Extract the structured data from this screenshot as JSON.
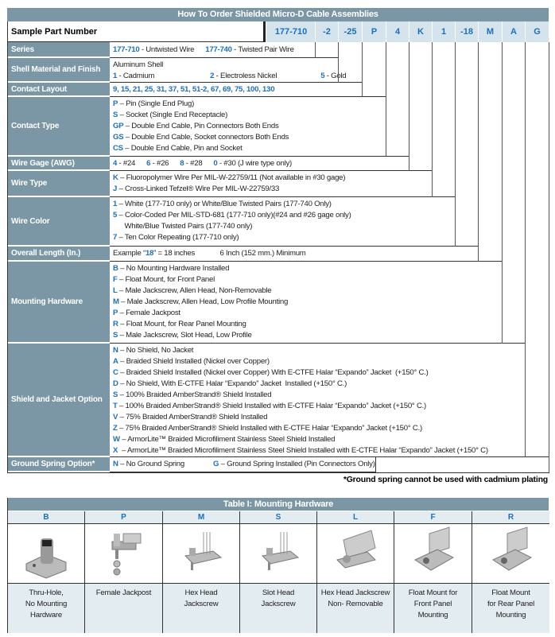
{
  "order": {
    "title": "How To Order Shielded Micro-D Cable Assemblies",
    "sample_label": "Sample Part Number",
    "part_codes": [
      "177-710",
      "-2",
      "-25",
      "P",
      "4",
      "K",
      "1",
      "-18",
      "M",
      "A",
      "G"
    ],
    "rows": [
      {
        "label": "Series",
        "lines": [
          [
            {
              "b": "177-710",
              "t": " - Untwisted Wire"
            },
            {
              "b": "177-740",
              "t": " - Twisted Pair Wire"
            }
          ]
        ]
      },
      {
        "label": "Shell Material and Finish",
        "lines": [
          [
            {
              "b": "",
              "t": "Aluminum Shell"
            }
          ],
          [
            {
              "b": "1",
              "t": " - Cadmium"
            },
            {
              "b": "2",
              "t": " - Electroless Nickel"
            },
            {
              "b": "5",
              "t": " - Gold"
            }
          ]
        ]
      },
      {
        "label": "Contact Layout",
        "lines": [
          [
            {
              "b": "9, 15, 21, 25, 31, 37, 51, 51-2, 67, 69, 75, 100, 130",
              "t": ""
            }
          ]
        ]
      },
      {
        "label": "Contact Type",
        "lines": [
          [
            {
              "b": "P",
              "t": " – Pin (Single End Plug)"
            }
          ],
          [
            {
              "b": "S",
              "t": " – Socket (Single End Receptacle)"
            }
          ],
          [
            {
              "b": "GP",
              "t": " – Double End Cable, Pin Connectors Both Ends"
            }
          ],
          [
            {
              "b": "GS",
              "t": " – Double End Cable, Socket connectors Both Ends"
            }
          ],
          [
            {
              "b": "CS",
              "t": " – Double End Cable, Pin and Socket"
            }
          ]
        ]
      },
      {
        "label": "Wire Gage (AWG)",
        "lines": [
          [
            {
              "b": "4",
              "t": " - #24"
            },
            {
              "b": "6",
              "t": " - #26"
            },
            {
              "b": "8",
              "t": " - #28"
            },
            {
              "b": "0",
              "t": " - #30 (J wire type only)"
            }
          ]
        ]
      },
      {
        "label": "Wire Type",
        "lines": [
          [
            {
              "b": "K",
              "t": " – Fluoropolymer Wire Per MIL-W-22759/11 (Not available in #30 gage)"
            }
          ],
          [
            {
              "b": "J",
              "t": " – Cross-Linked Tefzel® Wire Per MIL-W-22759/33"
            }
          ]
        ]
      },
      {
        "label": "Wire Color",
        "lines": [
          [
            {
              "b": "1",
              "t": " – White (177-710 only) or White/Blue Twisted Pairs (177-740 Only)"
            }
          ],
          [
            {
              "b": "5",
              "t": " – Color-Coded Per MIL-STD-681 (177-710 only)(#24 and #26 gage only)"
            }
          ],
          [
            {
              "b": "",
              "t": "      White/Blue Twisted Pairs (177-740 only)"
            }
          ],
          [
            {
              "b": "7",
              "t": " – Ten Color Repeating (177-710 only)"
            }
          ]
        ]
      },
      {
        "label": "Overall Length (In.)",
        "lines": [
          [
            {
              "b": "",
              "t": "Example “"
            },
            {
              "b": "18",
              "t": "” = 18 inches             6 Inch (152 mm.) Minimum"
            }
          ]
        ]
      },
      {
        "label": "Mounting Hardware",
        "lines": [
          [
            {
              "b": "B",
              "t": " – No Mounting Hardware Installed"
            }
          ],
          [
            {
              "b": "F",
              "t": " – Float Mount, for Front Panel"
            }
          ],
          [
            {
              "b": "L",
              "t": " – Male Jackscrew, Allen Head, Non-Removable"
            }
          ],
          [
            {
              "b": "M",
              "t": " – Male Jackscrew, Allen Head, Low Profile Mounting"
            }
          ],
          [
            {
              "b": "P",
              "t": " – Female Jackpost"
            }
          ],
          [
            {
              "b": "R",
              "t": " – Float Mount, for Rear Panel Mounting"
            }
          ],
          [
            {
              "b": "S",
              "t": " – Male Jackscrew, Slot Head, Low Profile"
            }
          ]
        ]
      },
      {
        "label": "Shield and Jacket Option",
        "lines": [
          [
            {
              "b": "N",
              "t": " – No Shield, No Jacket"
            }
          ],
          [
            {
              "b": "A",
              "t": " – Braided Shield Installed (Nickel over Copper)"
            }
          ],
          [
            {
              "b": "C",
              "t": " – Braided Shield Installed (Nickel over Copper) With E-CTFE Halar “Expando” Jacket  (+150° C.)"
            }
          ],
          [
            {
              "b": "D",
              "t": " – No Shield, With E-CTFE Halar “Expando” Jacket  Installed (+150° C.)"
            }
          ],
          [
            {
              "b": "S",
              "t": " – 100% Braided AmberStrand® Shield Installed"
            }
          ],
          [
            {
              "b": "T",
              "t": " – 100% Braided AmberStrand® Shield Installed with E-CTFE Halar “Expando” Jacket (+150° C.)"
            }
          ],
          [
            {
              "b": "V",
              "t": " – 75% Braided AmberStrand® Shield Installed"
            }
          ],
          [
            {
              "b": "Z",
              "t": " – 75% Braided AmberStrand® Shield Installed with E-CTFE Halar “Expando” Jacket (+150° C.)"
            }
          ],
          [
            {
              "b": "W",
              "t": " – ArmorLite™ Braided Microfiliment Stainless Steel Shield Installed"
            }
          ],
          [
            {
              "b": "X",
              "t": "  – ArmorLite™ Braided Microfiliment Stainless Steel Shield Installed with E-CTFE Halar “Expando” Jacket (+150° C)"
            }
          ]
        ]
      },
      {
        "label": "Ground Spring Option*",
        "lines": [
          [
            {
              "b": "N",
              "t": " – No Ground Spring"
            },
            {
              "b": "G",
              "t": " – Ground Spring Installed (Pin Connectors Only)"
            }
          ]
        ]
      }
    ],
    "footnote": "*Ground spring cannot be used with cadmium plating"
  },
  "mounting_table": {
    "title": "Table I: Mounting Hardware",
    "columns": [
      {
        "code": "B",
        "desc": "Thru-Hole,\nNo Mounting\nHardware"
      },
      {
        "code": "P",
        "desc": "Female Jackpost"
      },
      {
        "code": "M",
        "desc": "Hex Head\nJackscrew"
      },
      {
        "code": "S",
        "desc": "Slot Head\nJackscrew"
      },
      {
        "code": "L",
        "desc": "Hex Head Jackscrew\nNon- Removable"
      },
      {
        "code": "F",
        "desc": "Float Mount for\nFront Panel\nMounting"
      },
      {
        "code": "R",
        "desc": "Float Mount\nfor Rear Panel\nMounting"
      }
    ]
  },
  "colors": {
    "header": "#7b97a5",
    "code_blue": "#1a6fc0",
    "part_cell": "#d5e3ec"
  }
}
